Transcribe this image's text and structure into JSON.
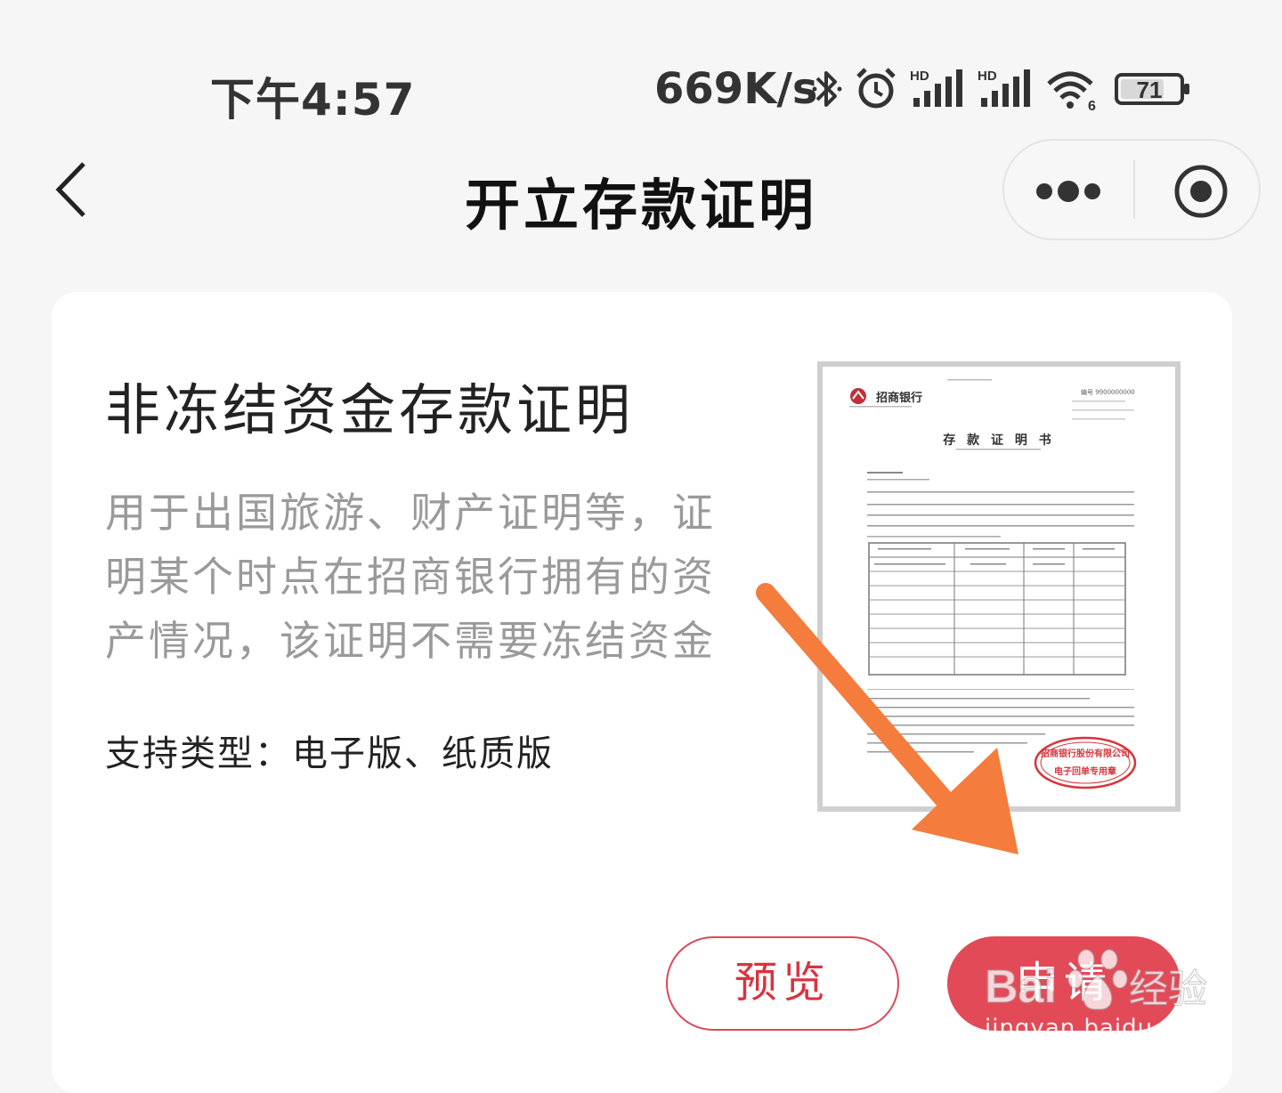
{
  "status_bar": {
    "time": "下午4:57",
    "network_speed": "669K/s",
    "battery_level": "71",
    "icons": [
      "bluetooth-icon",
      "alarm-icon",
      "signal-hd-icon",
      "signal-hd-icon",
      "wifi6-icon",
      "battery-icon"
    ]
  },
  "nav": {
    "title": "开立存款证明",
    "back_icon": "chevron-left-icon",
    "more_icon": "more-dots-icon",
    "close_icon": "target-circle-icon"
  },
  "card": {
    "title": "非冻结资金存款证明",
    "description": "用于出国旅游、财产证明等，证明某个时点在招商银行拥有的资产情况，该证明不需要冻结资金",
    "types": "支持类型：电子版、纸质版"
  },
  "certificate_preview": {
    "bank_name": "招商银行",
    "doc_title": "存 款 证 明 书",
    "number": "编号 9900000000",
    "seal_line1": "招商银行股份有限公司",
    "seal_line2": "电子回单专用章"
  },
  "actions": {
    "preview_label": "预览",
    "apply_label": "申请"
  },
  "watermark": {
    "brand": "Bai 经验",
    "url": "jingyan.baidu.com"
  },
  "colors": {
    "accent": "#e24a58",
    "arrow": "#f47c3c"
  }
}
